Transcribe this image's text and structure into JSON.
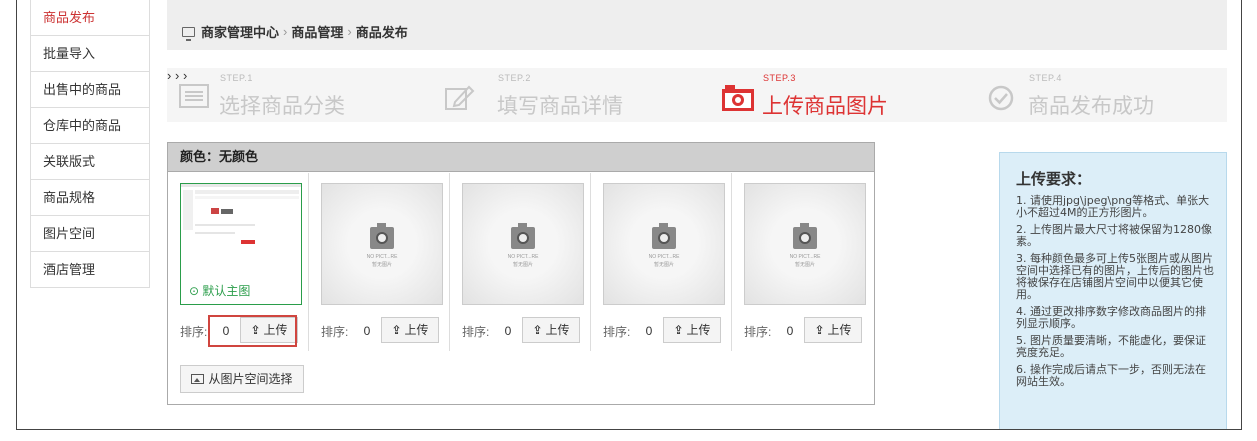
{
  "sidebar": {
    "items": [
      {
        "label": "商品发布",
        "active": true
      },
      {
        "label": "批量导入"
      },
      {
        "label": "出售中的商品"
      },
      {
        "label": "仓库中的商品"
      },
      {
        "label": "关联版式"
      },
      {
        "label": "商品规格"
      },
      {
        "label": "图片空间"
      },
      {
        "label": "酒店管理"
      }
    ]
  },
  "breadcrumb": {
    "icon": "monitor-icon",
    "items": [
      "商家管理中心",
      "商品管理",
      "商品发布"
    ],
    "separator": "›"
  },
  "steps": [
    {
      "tag": "STEP.1",
      "label": "选择商品分类",
      "icon": "list-icon"
    },
    {
      "tag": "STEP.2",
      "label": "填写商品详情",
      "icon": "edit-icon"
    },
    {
      "tag": "STEP.3",
      "label": "上传商品图片",
      "icon": "camera-icon",
      "current": true
    },
    {
      "tag": "STEP.4",
      "label": "商品发布成功",
      "icon": "check-circle-icon"
    }
  ],
  "color_panel": {
    "header": "颜色：无颜色",
    "default_label": "默认主图",
    "sort_label": "排序:",
    "upload_label": "上传",
    "placeholder_text": [
      "NO PICT...RE",
      "暂无图片"
    ],
    "slots": [
      {
        "sort": "0",
        "is_main": true
      },
      {
        "sort": "0"
      },
      {
        "sort": "0"
      },
      {
        "sort": "0"
      },
      {
        "sort": "0"
      }
    ],
    "choose_button": "从图片空间选择"
  },
  "requirements": {
    "title": "上传要求：",
    "items": [
      "1. 请使用jpg\\jpeg\\png等格式、单张大小不超过4M的正方形图片。",
      "2. 上传图片最大尺寸将被保留为1280像素。",
      "3. 每种颜色最多可上传5张图片或从图片空间中选择已有的图片，上传后的图片也将被保存在店铺图片空间中以便其它使用。",
      "4. 通过更改排序数字修改商品图片的排列显示顺序。",
      "5. 图片质量要清晰，不能虚化，要保证亮度充足。",
      "6. 操作完成后请点下一步，否则无法在网站生效。"
    ]
  },
  "colors": {
    "accent_red": "#d33333",
    "green": "#2a9d4a",
    "info_bg": "#dceef8"
  }
}
